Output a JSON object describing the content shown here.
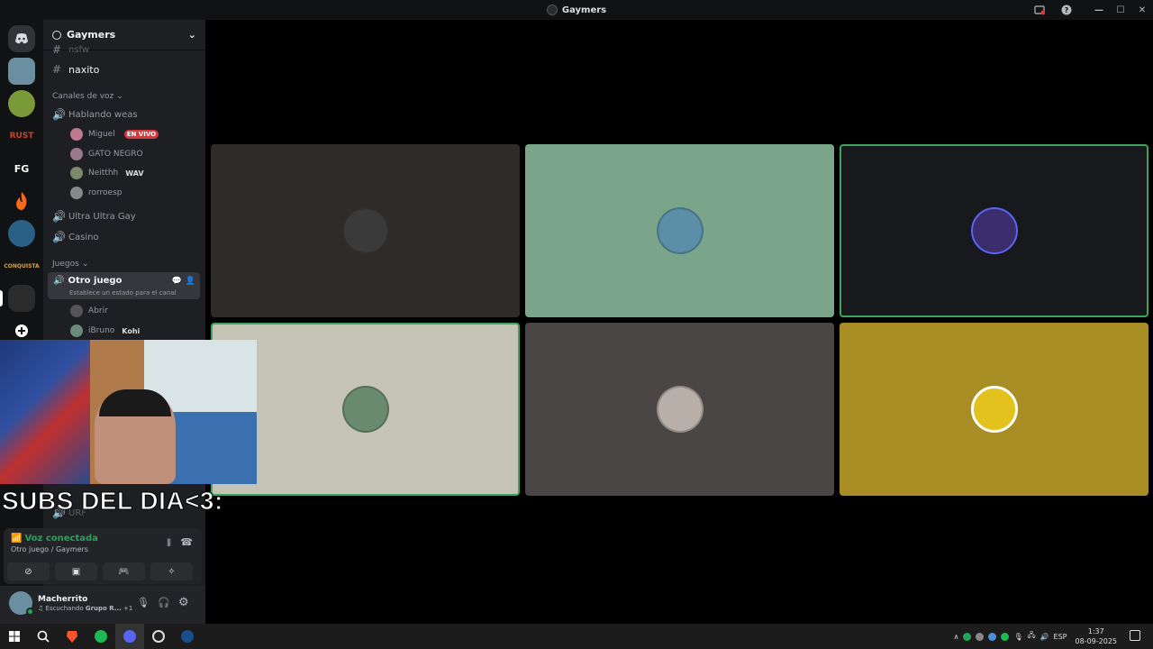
{
  "window": {
    "title": "Gaymers"
  },
  "server": {
    "name": "Gaymers"
  },
  "channels": {
    "partial_top": "nsfw",
    "text_channel": "naxito",
    "voice_category": "Canales de voz",
    "voice_channel_1": "Hablando weas",
    "members_1": [
      {
        "name": "Miguel",
        "badge": "EN VIVO"
      },
      {
        "name": "GATO NEGRO"
      },
      {
        "name": "Neitthh",
        "tag": "WAV"
      },
      {
        "name": "rorroesp"
      }
    ],
    "voice_channel_2": "Ultra Ultra Gay",
    "voice_channel_3": "Casino",
    "games_category": "Juegos",
    "active_channel": "Otro juego",
    "active_status": "Establece un estado para el canal",
    "members_2": [
      {
        "name": "Abrir"
      },
      {
        "name": "iBruno",
        "tag": "Kohi"
      }
    ],
    "hidden_channel": "URF"
  },
  "overlay": {
    "subs_text": "SUBS DEL DIA<3:"
  },
  "voice_status": {
    "title": "Voz conectada",
    "channel": "Otro juego",
    "server": "/ Gaymers"
  },
  "user": {
    "name": "Macherrito",
    "activity_prefix": "Escuchando",
    "activity_bold": "Grupo R...",
    "extra": "+1"
  },
  "tiles": [
    {
      "bg": "#2e2b28",
      "avatar": "#3a3a3a"
    },
    {
      "bg": "#7aa58a",
      "avatar": "#5b8fa8"
    },
    {
      "bg": "#18191c",
      "avatar": "#3b2d6b"
    },
    {
      "bg": "#c5c3b5",
      "avatar": "#6a8a70"
    },
    {
      "bg": "#4a4646",
      "avatar": "#b8b0a8"
    },
    {
      "bg": "#a88d24",
      "avatar": "#e4c21d"
    }
  ],
  "tray": {
    "language": "ESP",
    "time": "1:37",
    "date": "08-09-2025"
  }
}
